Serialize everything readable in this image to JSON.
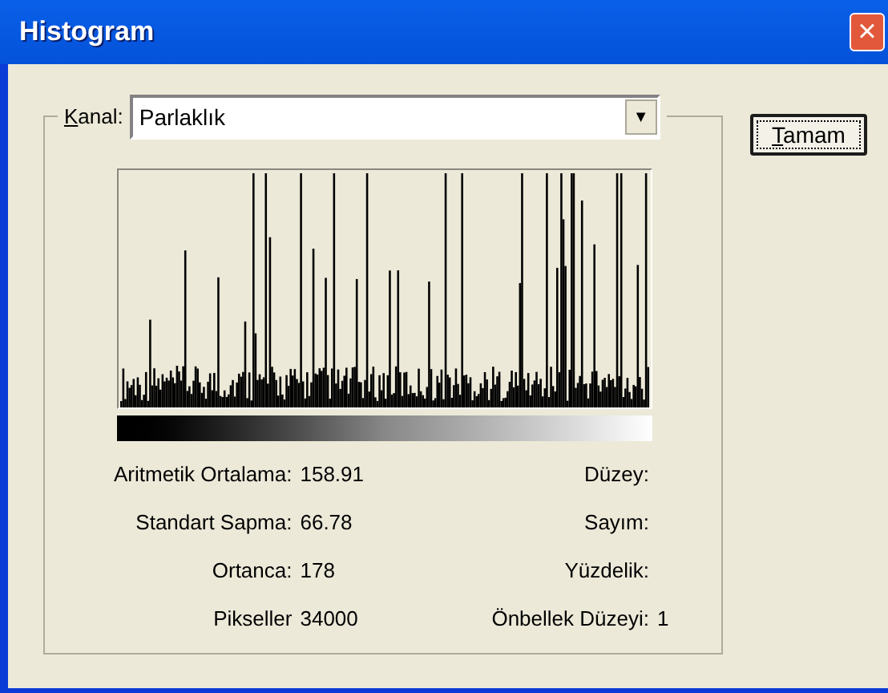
{
  "window": {
    "title": "Histogram",
    "close": "×"
  },
  "channel": {
    "label": "Kanal:",
    "value": "Parlaklık",
    "arrow": "▼"
  },
  "ok_button": "Tamam",
  "stats_left": [
    {
      "label": "Aritmetik Ortalama:",
      "value": "158.91"
    },
    {
      "label": "Standart Sapma:",
      "value": "66.78"
    },
    {
      "label": "Ortanca:",
      "value": "178"
    },
    {
      "label": "Pikseller",
      "value": "34000"
    }
  ],
  "stats_right": [
    {
      "label": "Düzey:"
    },
    {
      "label": "Sayım:"
    },
    {
      "label": "Yüzdelik:"
    },
    {
      "label": "Önbellek Düzeyi:",
      "value": "1"
    }
  ]
}
